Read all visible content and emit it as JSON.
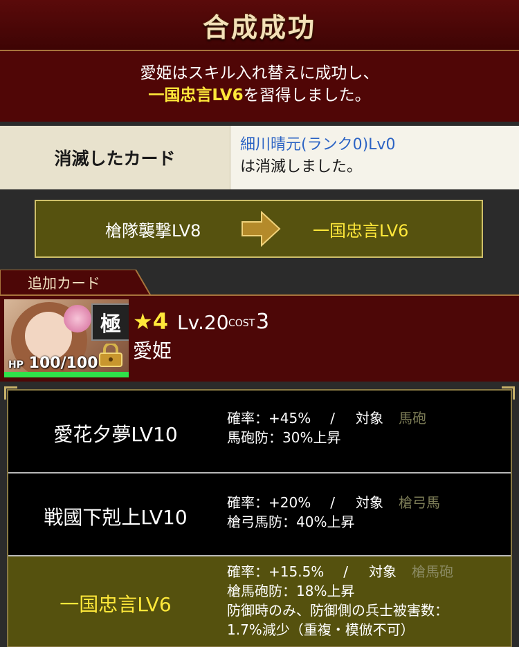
{
  "header": {
    "title": "合成成功"
  },
  "message": {
    "line1": "愛姫はスキル入れ替えに成功し、",
    "skill": "一国忠言LV6",
    "line2_suffix": "を習得しました。"
  },
  "lost_card": {
    "label": "消滅したカード",
    "card": "細川晴元(ランク0)Lv0",
    "suffix": "は消滅しました。"
  },
  "swap": {
    "from": "槍隊襲撃LV8",
    "to": "一国忠言LV6",
    "arrow_icon": "right-arrow-icon"
  },
  "added_card": {
    "tab": "追加カード",
    "rarity_icon": "★",
    "rarity": "4",
    "level": "Lv.20",
    "cost_label": "COST",
    "cost": "3",
    "name": "愛姫",
    "badge": "極",
    "hp_label": "HP",
    "hp": "100/100"
  },
  "skills": [
    {
      "name": "愛花夕夢LV10",
      "rate_label": "確率：+45%",
      "sep": "/",
      "target_label": "対象",
      "target": "馬砲",
      "effect1": "馬砲防：30%上昇",
      "effect2": ""
    },
    {
      "name": "戦國下剋上LV10",
      "rate_label": "確率：+20%",
      "sep": "/",
      "target_label": "対象",
      "target": "槍弓馬",
      "effect1": "槍弓馬防：40%上昇",
      "effect2": ""
    },
    {
      "name": "一国忠言LV6",
      "rate_label": "確率：+15.5%",
      "sep": "/",
      "target_label": "対象",
      "target": "槍馬砲",
      "effect1": "槍馬砲防：18%上昇",
      "effect2": "防御時のみ、防御側の兵士被害数：",
      "effect3": "1.7%減少（重複・模倣不可）"
    }
  ],
  "colors": {
    "accent": "#ffe83a",
    "panel": "#500606",
    "olive": "#56520f"
  }
}
